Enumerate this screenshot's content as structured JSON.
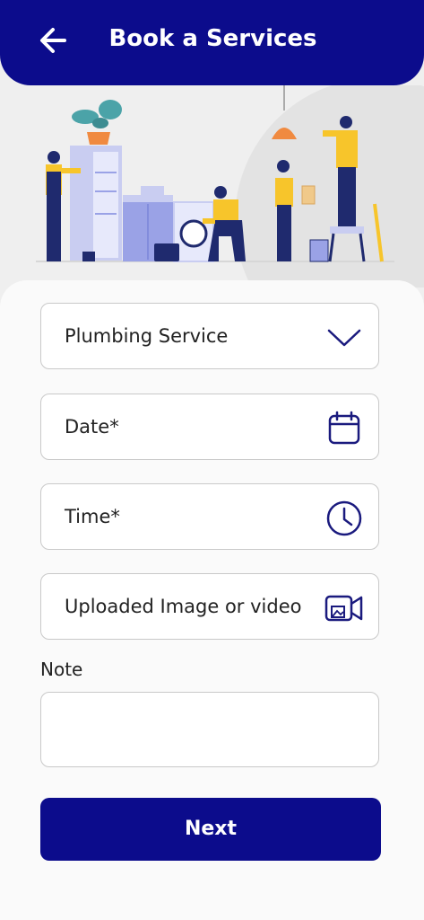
{
  "header": {
    "title": "Book a Services",
    "back_icon": "arrow-left-icon"
  },
  "colors": {
    "primary": "#0c0c8c",
    "accent": "#f7c52b",
    "illustration_light": "#c9cdf1"
  },
  "form": {
    "service": {
      "value": "Plumbing Service",
      "icon": "chevron-down-icon"
    },
    "date": {
      "label": "Date*",
      "icon": "calendar-icon"
    },
    "time": {
      "label": "Time*",
      "icon": "clock-icon"
    },
    "media": {
      "label": "Uploaded Image or video",
      "icon": "image-video-icon"
    },
    "note_label": "Note",
    "note_value": ""
  },
  "next_label": "Next"
}
